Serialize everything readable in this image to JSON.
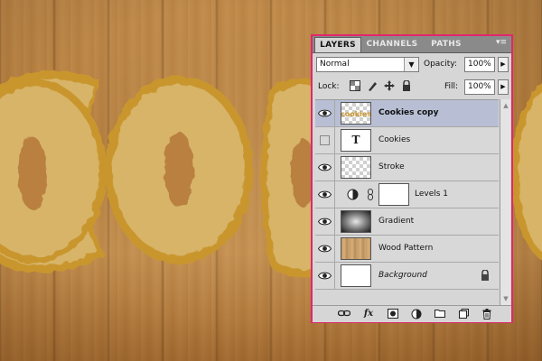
{
  "canvas": {
    "wood_color": "#b98041",
    "cookie_fill": "#d7b467",
    "cookie_edge": "#c9962f"
  },
  "panel": {
    "accent_border": "#e0276e",
    "tabs": [
      {
        "label": "LAYERS",
        "active": true
      },
      {
        "label": "CHANNELS",
        "active": false
      },
      {
        "label": "PATHS",
        "active": false
      }
    ],
    "menu_icon": "panel-menu-icon",
    "blend_mode": "Normal",
    "opacity_label": "Opacity:",
    "opacity_value": "100%",
    "lock_label": "Lock:",
    "fill_label": "Fill:",
    "fill_value": "100%",
    "layers": [
      {
        "name": "Cookies copy",
        "visible": true,
        "selected": true,
        "thumb": "text-raster"
      },
      {
        "name": "Cookies",
        "visible": false,
        "selected": false,
        "thumb": "text-layer",
        "thumb_glyph": "T"
      },
      {
        "name": "Stroke",
        "visible": true,
        "selected": false,
        "thumb": "transparent"
      },
      {
        "name": "Levels 1",
        "visible": true,
        "selected": false,
        "thumb": "adjustment"
      },
      {
        "name": "Gradient",
        "visible": true,
        "selected": false,
        "thumb": "gradient"
      },
      {
        "name": "Wood Pattern",
        "visible": true,
        "selected": false,
        "thumb": "wood"
      },
      {
        "name": "Background",
        "visible": true,
        "selected": false,
        "thumb": "white",
        "locked": true
      }
    ],
    "toolbar_icons": [
      "link-icon",
      "fx-icon",
      "mask-icon",
      "adjustment-icon",
      "group-icon",
      "new-layer-icon",
      "trash-icon"
    ],
    "toolbar_fx_label": "fx"
  }
}
